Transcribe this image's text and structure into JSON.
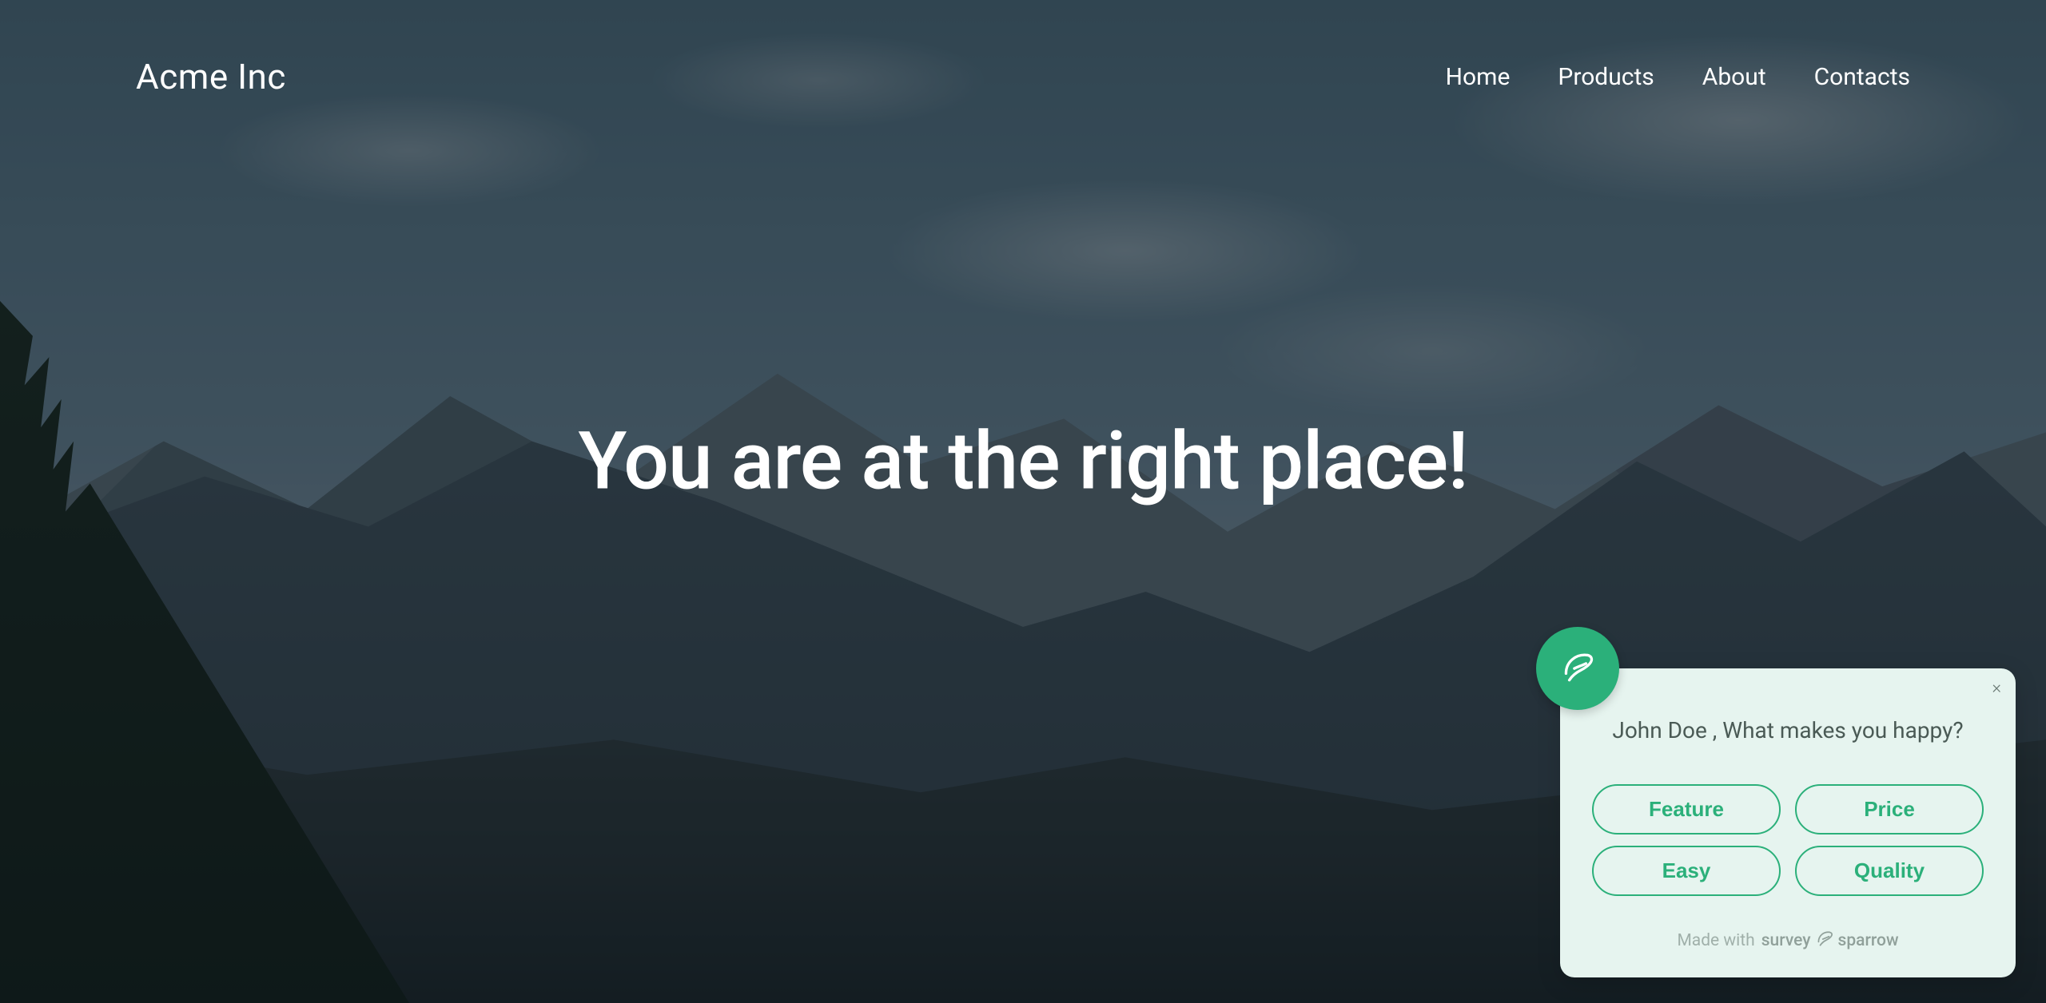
{
  "header": {
    "brand": "Acme Inc",
    "nav": [
      {
        "label": "Home"
      },
      {
        "label": "Products"
      },
      {
        "label": "About"
      },
      {
        "label": "Contacts"
      }
    ]
  },
  "hero": {
    "title": "You are at the right place!"
  },
  "survey": {
    "question": "John Doe , What makes you happy?",
    "options": [
      {
        "label": "Feature"
      },
      {
        "label": "Price"
      },
      {
        "label": "Easy"
      },
      {
        "label": "Quality"
      }
    ],
    "footer_prefix": "Made with",
    "footer_brand_left": "survey",
    "footer_brand_right": "sparrow",
    "close_glyph": "×"
  },
  "colors": {
    "accent": "#2bb07a",
    "widget_bg": "#e6f4ef"
  }
}
